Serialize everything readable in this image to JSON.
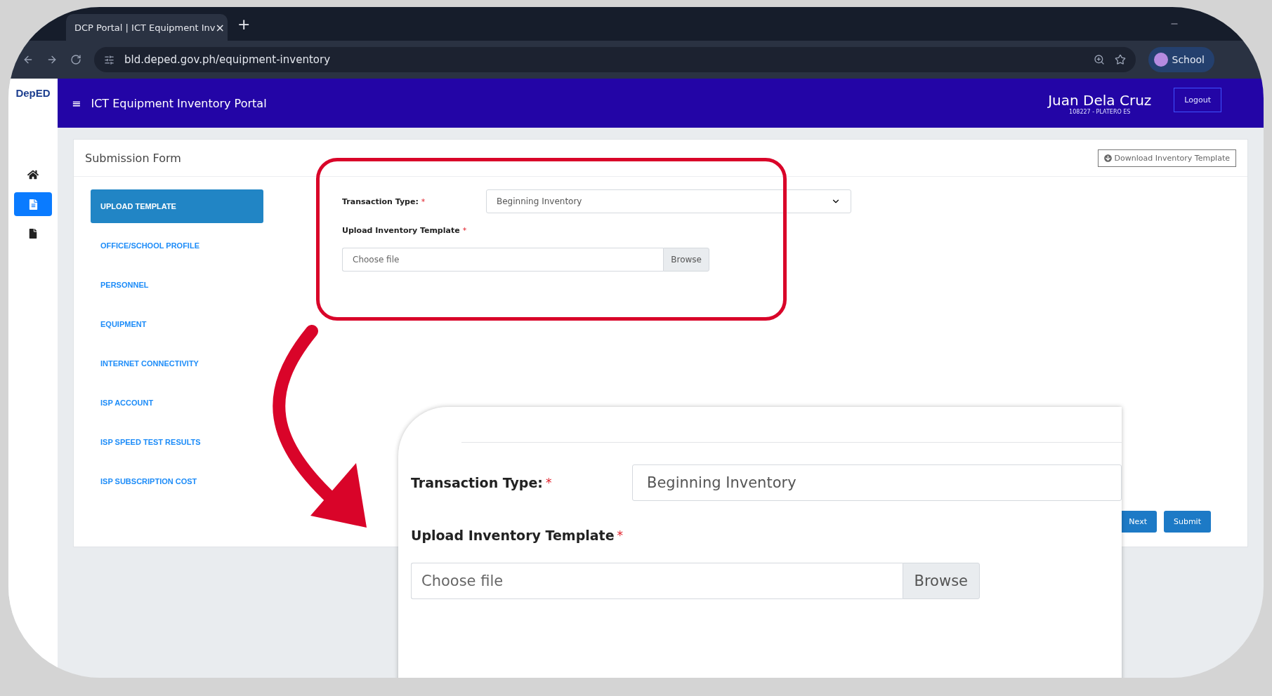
{
  "browser": {
    "tab_title": "DCP Portal | ICT Equipment Inv",
    "tab_close": "×",
    "new_tab": "+",
    "url": "bld.deped.gov.ph/equipment-inventory",
    "profile": "School"
  },
  "header": {
    "logo": "DepED",
    "menu": "≡",
    "title": "ICT Equipment Inventory Portal",
    "user_name": "Juan Dela Cruz",
    "user_sub": "108227 - PLATERO ES",
    "logout": "Logout"
  },
  "rail": [
    {
      "kind": "home",
      "selected": false
    },
    {
      "kind": "form",
      "selected": true
    },
    {
      "kind": "file",
      "selected": false
    }
  ],
  "card": {
    "title": "Submission Form",
    "download": "Download Inventory Template"
  },
  "steps": [
    {
      "label": "UPLOAD TEMPLATE",
      "selected": true
    },
    {
      "label": "OFFICE/SCHOOL PROFILE",
      "selected": false
    },
    {
      "label": "PERSONNEL",
      "selected": false
    },
    {
      "label": "EQUIPMENT",
      "selected": false
    },
    {
      "label": "INTERNET CONNECTIVITY",
      "selected": false
    },
    {
      "label": "ISP ACCOUNT",
      "selected": false
    },
    {
      "label": "ISP SPEED TEST RESULTS",
      "selected": false
    },
    {
      "label": "ISP SUBSCRIPTION COST",
      "selected": false
    }
  ],
  "form": {
    "transaction_label": "Transaction Type:",
    "required": "*",
    "transaction_value": "Beginning Inventory",
    "upload_label": "Upload Inventory Template",
    "upload_required": "*",
    "placeholder": "Choose file",
    "browse": "Browse"
  },
  "buttons": [
    "Next",
    "Submit"
  ],
  "callout": {
    "transaction_label": "Transaction Type:",
    "required": "*",
    "transaction_value": "Beginning Inventory",
    "upload_label": "Upload Inventory Template",
    "upload_required": "*",
    "placeholder": "Choose file",
    "browse": "Browse"
  }
}
